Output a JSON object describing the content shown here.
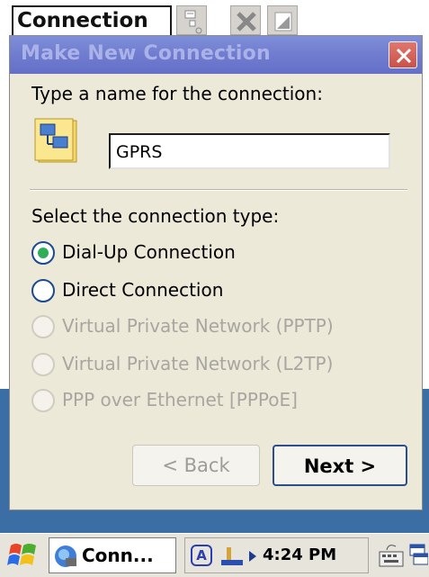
{
  "window": {
    "menu_label": "Connection",
    "toolbar_icons": [
      "properties-icon",
      "delete-icon",
      "copy-icon"
    ]
  },
  "dialog": {
    "title": "Make New Connection",
    "name_prompt": "Type a name for the connection:",
    "name_value": "GPRS",
    "type_prompt": "Select the connection type:",
    "options": [
      {
        "label": "Dial-Up Connection",
        "selected": true,
        "enabled": true
      },
      {
        "label": "Direct Connection",
        "selected": false,
        "enabled": true
      },
      {
        "label": "Virtual Private Network (PPTP)",
        "selected": false,
        "enabled": false
      },
      {
        "label": "Virtual Private Network (L2TP)",
        "selected": false,
        "enabled": false
      },
      {
        "label": "PPP over Ethernet [PPPoE]",
        "selected": false,
        "enabled": false
      }
    ],
    "back_label": "< Back",
    "next_label": "Next >"
  },
  "taskbar": {
    "task_label": "Conn...",
    "input_indicator": "A",
    "time": "4:24 PM"
  },
  "colors": {
    "titlebar": "#6f7ccf",
    "dialog_bg": "#ece9d8",
    "desktop": "#3a6ea5",
    "radio_selected": "#2fae5a"
  }
}
